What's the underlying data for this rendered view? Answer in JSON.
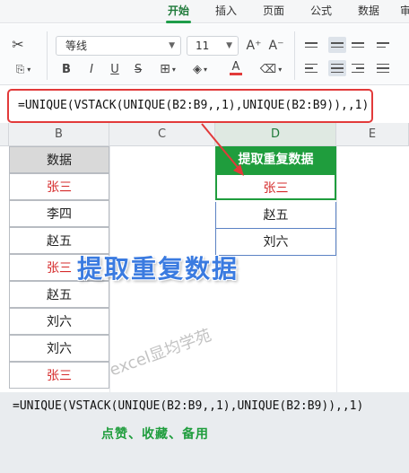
{
  "ribbon": {
    "tabs": [
      {
        "label": "开始",
        "active": true
      },
      {
        "label": "插入",
        "active": false
      },
      {
        "label": "页面",
        "active": false
      },
      {
        "label": "公式",
        "active": false
      },
      {
        "label": "数据",
        "active": false
      },
      {
        "label": "审",
        "active": false
      }
    ]
  },
  "toolbar": {
    "font_name": "等线",
    "font_size": "11",
    "bold": "B",
    "italic": "I",
    "underline": "U",
    "strikethrough": "S",
    "grow_font": "A⁺",
    "shrink_font": "A⁻",
    "font_color": "A",
    "accent_color": "#e23a3a"
  },
  "formula_bar": {
    "text": "=UNIQUE(VSTACK(UNIQUE(B2:B9,,1),UNIQUE(B2:B9)),,1)"
  },
  "grid": {
    "columns": [
      "B",
      "C",
      "D",
      "E"
    ],
    "column_b": {
      "header": "数据",
      "rows": [
        {
          "value": "张三",
          "red": true
        },
        {
          "value": "李四",
          "red": false
        },
        {
          "value": "赵五",
          "red": false
        },
        {
          "value": "张三",
          "red": true
        },
        {
          "value": "赵五",
          "red": false
        },
        {
          "value": "刘六",
          "red": false
        },
        {
          "value": "刘六",
          "red": false
        },
        {
          "value": "张三",
          "red": true
        }
      ]
    },
    "column_d": {
      "header": "提取重复数据",
      "rows": [
        "张三",
        "赵五",
        "刘六"
      ]
    }
  },
  "overlay": {
    "title": "提取重复数据",
    "watermark": "excel显均学苑"
  },
  "bottom": {
    "formula": "=UNIQUE(VSTACK(UNIQUE(B2:B9,,1),UNIQUE(B2:B9)),,1)",
    "note": "点赞、收藏、备用"
  }
}
